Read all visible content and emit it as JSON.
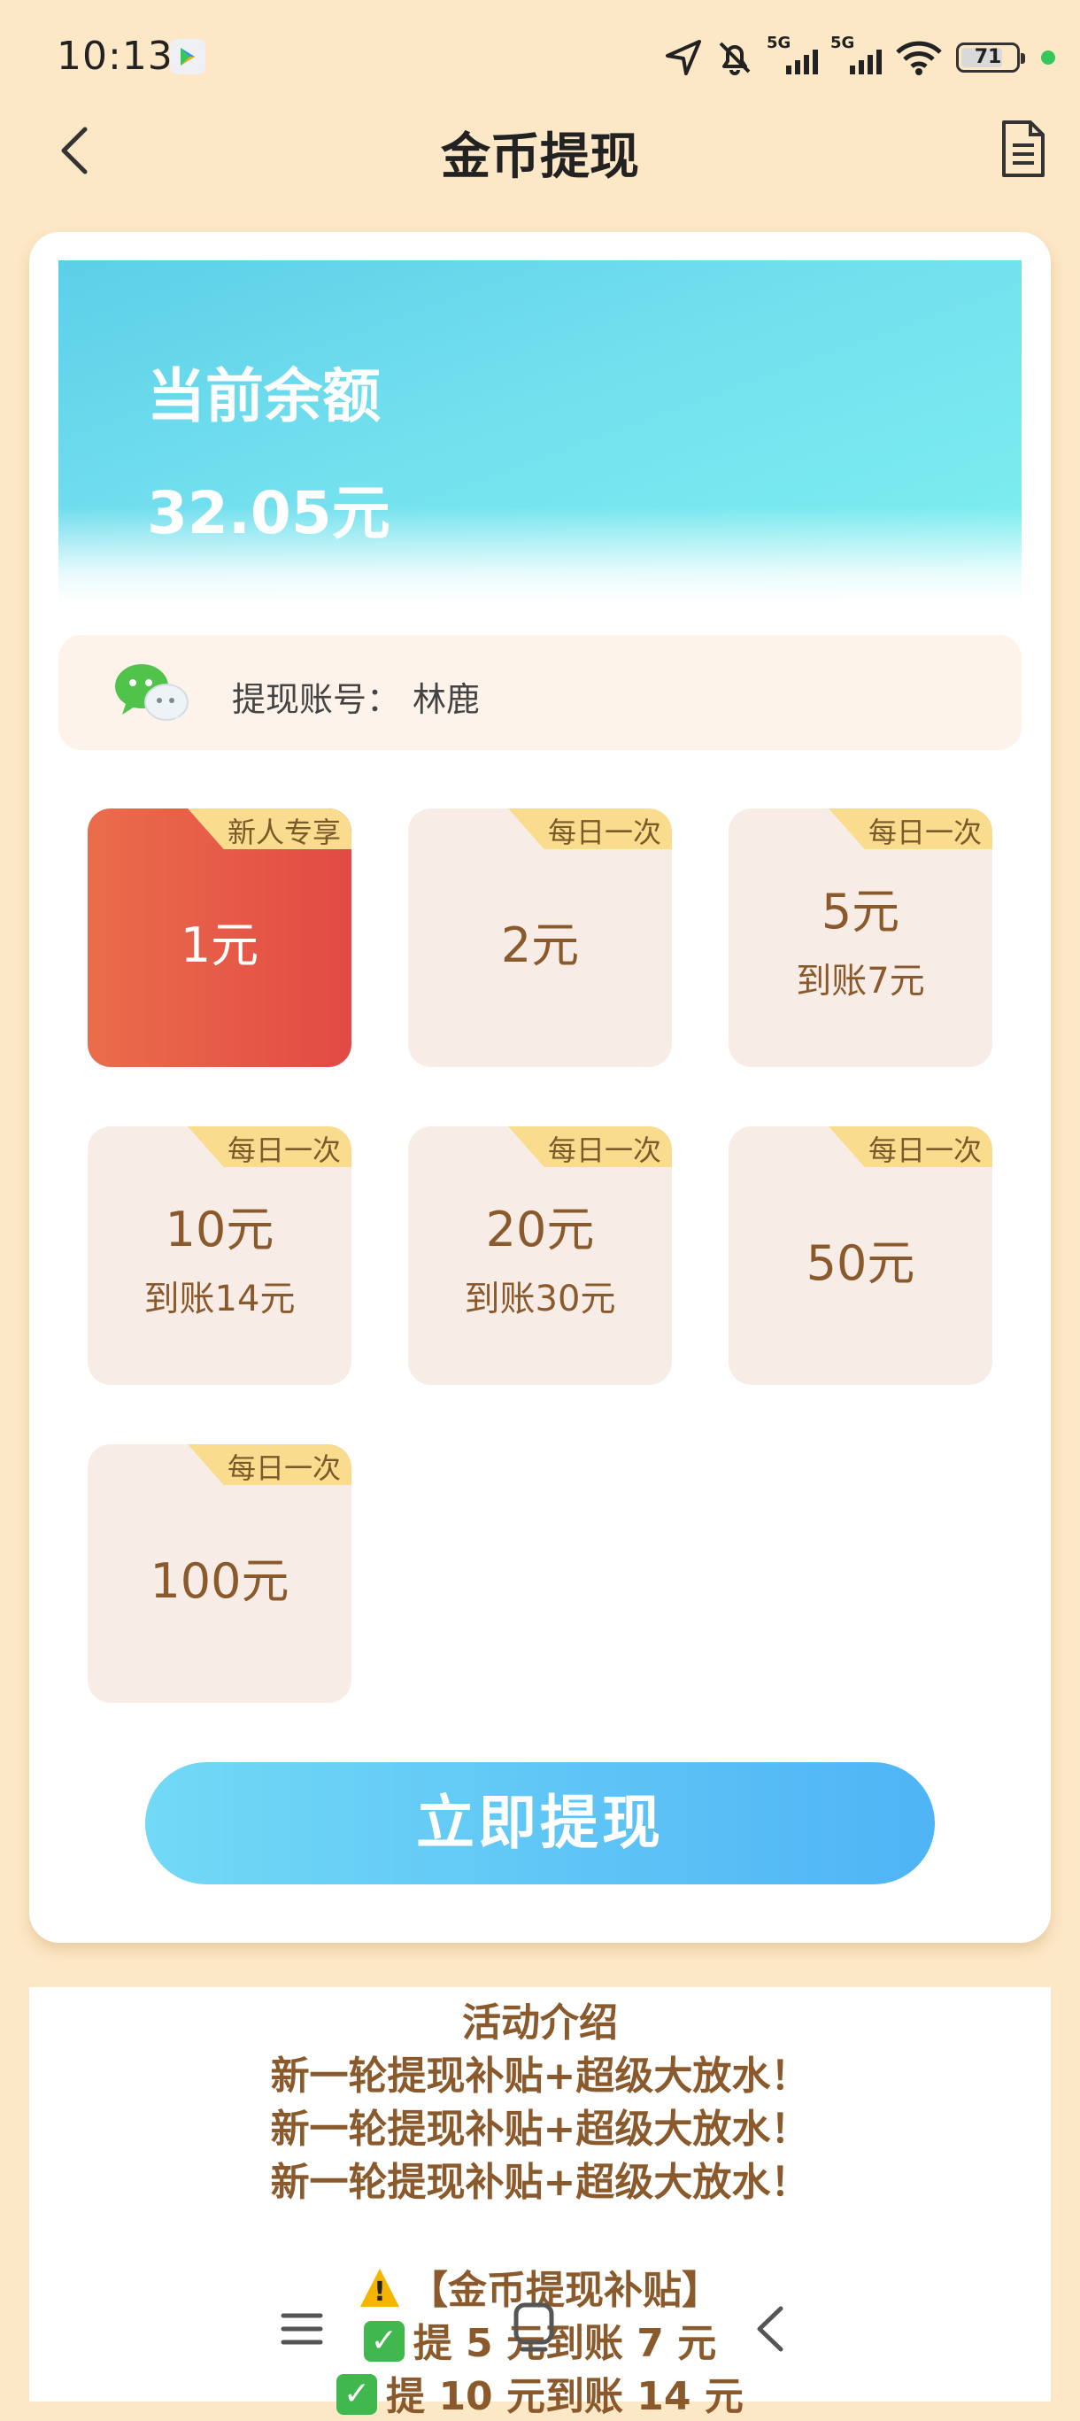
{
  "status_bar": {
    "time": "10:13",
    "network1": "5G",
    "network2": "5G",
    "battery": "71"
  },
  "header": {
    "title": "金币提现"
  },
  "balance": {
    "label": "当前余额",
    "amount": "32.05元"
  },
  "account": {
    "label": "提现账号：",
    "name": "林鹿"
  },
  "options": [
    {
      "tag": "新人专享",
      "amount": "1元",
      "credit": "",
      "selected": true
    },
    {
      "tag": "每日一次",
      "amount": "2元",
      "credit": "",
      "selected": false
    },
    {
      "tag": "每日一次",
      "amount": "5元",
      "credit": "到账7元",
      "selected": false
    },
    {
      "tag": "每日一次",
      "amount": "10元",
      "credit": "到账14元",
      "selected": false
    },
    {
      "tag": "每日一次",
      "amount": "20元",
      "credit": "到账30元",
      "selected": false
    },
    {
      "tag": "每日一次",
      "amount": "50元",
      "credit": "",
      "selected": false
    },
    {
      "tag": "每日一次",
      "amount": "100元",
      "credit": "",
      "selected": false
    }
  ],
  "withdraw_button": "立即提现",
  "intro": {
    "title": "活动介绍",
    "lines": [
      "新一轮提现补贴+超级大放水！",
      "新一轮提现补贴+超级大放水！",
      "新一轮提现补贴+超级大放水！"
    ],
    "subsidy_heading": "【金币提现补贴】",
    "rules": [
      "提 5 元到账 7 元",
      "提 10 元到账 14 元"
    ]
  },
  "colors": {
    "page_bg": "#fce7c6",
    "accent_text": "#8a5a2c",
    "selected_option": "#e24a44",
    "button_blue": "#4fb4f5"
  }
}
